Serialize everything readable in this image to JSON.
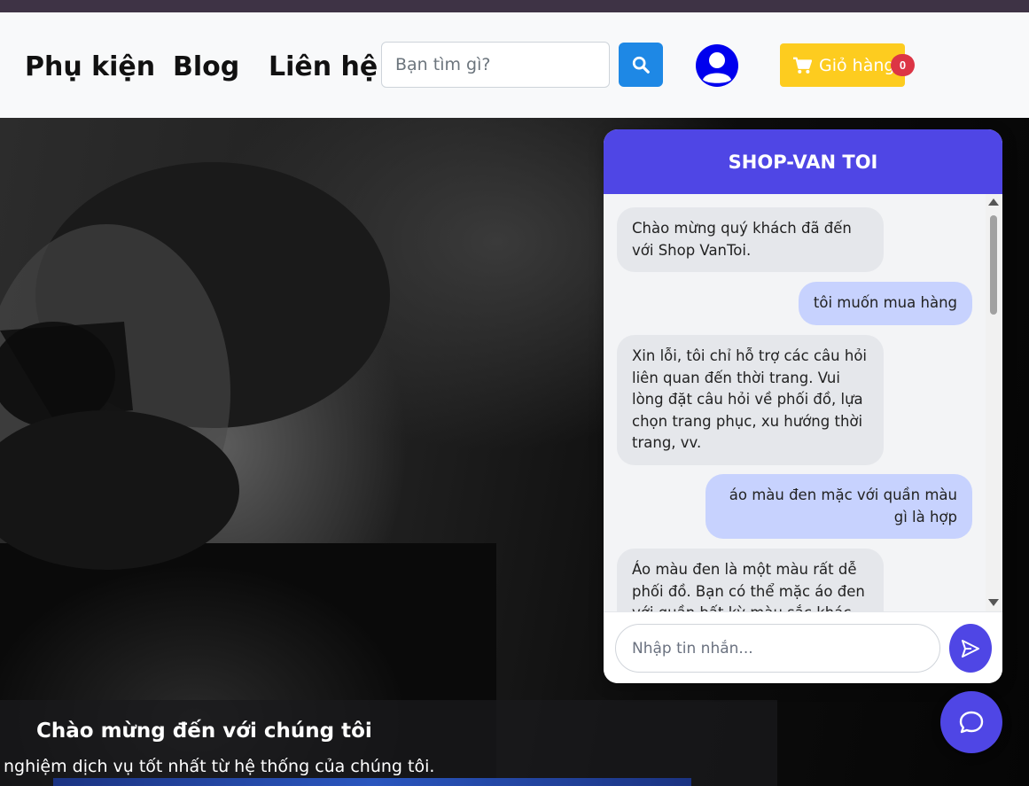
{
  "nav": {
    "links": [
      "Phụ kiện",
      "Blog",
      "Liên hệ"
    ],
    "search_placeholder": "Bạn tìm gì?",
    "cart_label": "Giỏ hàng",
    "cart_count": "0"
  },
  "hero": {
    "title": "Chào mừng đến với chúng tôi",
    "subtitle": "nghiệm dịch vụ tốt nhất từ hệ thống của chúng tôi."
  },
  "chat": {
    "title": "SHOP-VAN TOI",
    "messages": [
      {
        "role": "bot",
        "text": "Chào mừng quý khách đã đến với Shop VanToi."
      },
      {
        "role": "user",
        "text": "tôi muốn mua hàng"
      },
      {
        "role": "bot",
        "text": "Xin lỗi, tôi chỉ hỗ trợ các câu hỏi liên quan đến thời trang. Vui lòng đặt câu hỏi về phối đồ, lựa chọn trang phục, xu hướng thời trang, vv."
      },
      {
        "role": "user",
        "text": "áo màu đen mặc với quần màu gì là hợp"
      },
      {
        "role": "bot",
        "text": "Áo màu đen là một màu rất dễ phối đồ. Bạn có thể mặc áo đen với quần bất kỳ màu sắc khác"
      }
    ],
    "input_placeholder": "Nhập tin nhắn..."
  },
  "icons": {
    "search": "search-icon",
    "user": "user-circle-icon",
    "cart": "cart-icon",
    "send": "send-icon",
    "chat_fab": "chat-bubble-icon"
  },
  "colors": {
    "primary": "#4f46e5",
    "search_button": "#1e88e5",
    "cart_button": "#fdcc1f",
    "badge": "#dc3545",
    "user_icon": "#0000ee"
  }
}
